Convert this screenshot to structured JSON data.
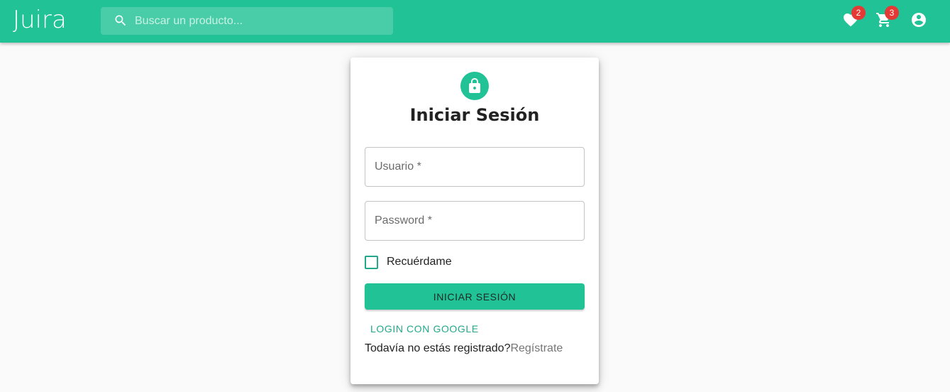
{
  "header": {
    "logo": "Juira",
    "search_placeholder": "Buscar un producto...",
    "favorites_count": "2",
    "cart_count": "3",
    "icons": [
      "search-icon",
      "heart-icon",
      "cart-icon",
      "account-circle-icon"
    ],
    "bar_color": "#22c297"
  },
  "login": {
    "title": "Iniciar Sesión",
    "username_label": "Usuario *",
    "password_label": "Password *",
    "remember_label": "Recuérdame",
    "remember_checked": false,
    "submit_label": "INICIAR SESIÓN",
    "google_label": "LOGIN CON GOOGLE",
    "register_prompt": "Todavía no estás registrado?",
    "register_link": "Regístrate",
    "lock_icon": "lock-icon"
  },
  "colors": {
    "accent": "#22c297",
    "badge": "#e53935"
  }
}
